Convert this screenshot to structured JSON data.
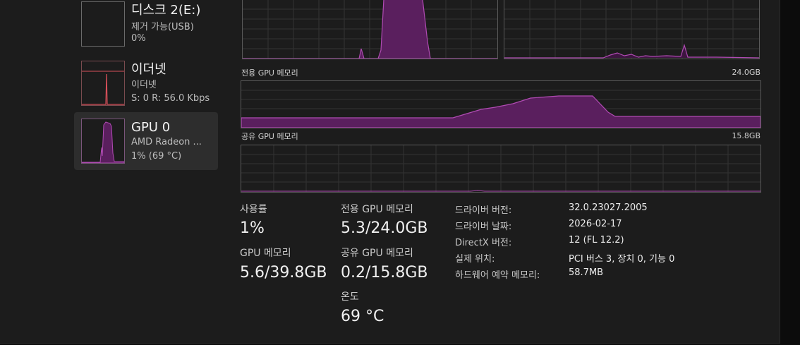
{
  "sidebar": {
    "items": [
      {
        "title": "디스크 2(E:)",
        "subtitle": "제거 가능(USB)",
        "detail": "0%"
      },
      {
        "title": "이더넷",
        "subtitle": "이더넷",
        "detail": "S: 0 R: 56.0 Kbps"
      },
      {
        "title": "GPU 0",
        "subtitle": "AMD Radeon ...",
        "detail": "1% (69 °C)"
      }
    ]
  },
  "graphs": {
    "dedicated": {
      "label": "전용 GPU 메모리",
      "max": "24.0GB"
    },
    "shared": {
      "label": "공유 GPU 메모리",
      "max": "15.8GB"
    }
  },
  "stats": {
    "usage": {
      "label": "사용률",
      "value": "1%"
    },
    "gpu_memory": {
      "label": "GPU 메모리",
      "value": "5.6/39.8GB"
    },
    "dedicated_memory": {
      "label": "전용 GPU 메모리",
      "value": "5.3/24.0GB"
    },
    "shared_memory": {
      "label": "공유 GPU 메모리",
      "value": "0.2/15.8GB"
    },
    "temperature": {
      "label": "온도",
      "value": "69 °C"
    }
  },
  "info": [
    {
      "key": "드라이버 버전:",
      "value": "32.0.23027.2005"
    },
    {
      "key": "드라이버 날짜:",
      "value": "2026-02-17"
    },
    {
      "key": "DirectX 버전:",
      "value": "12 (FL 12.2)"
    },
    {
      "key": "실제 위치:",
      "value": "PCI 버스 3, 장치 0, 기능 0"
    },
    {
      "key": "하드웨어 예약 메모리:",
      "value": "58.7MB"
    }
  ],
  "colors": {
    "gpu_line": "#b04bb3",
    "gpu_fill": "#5a1f5e",
    "eth_line": "#d9505a",
    "grid": "#3a3a3a"
  }
}
